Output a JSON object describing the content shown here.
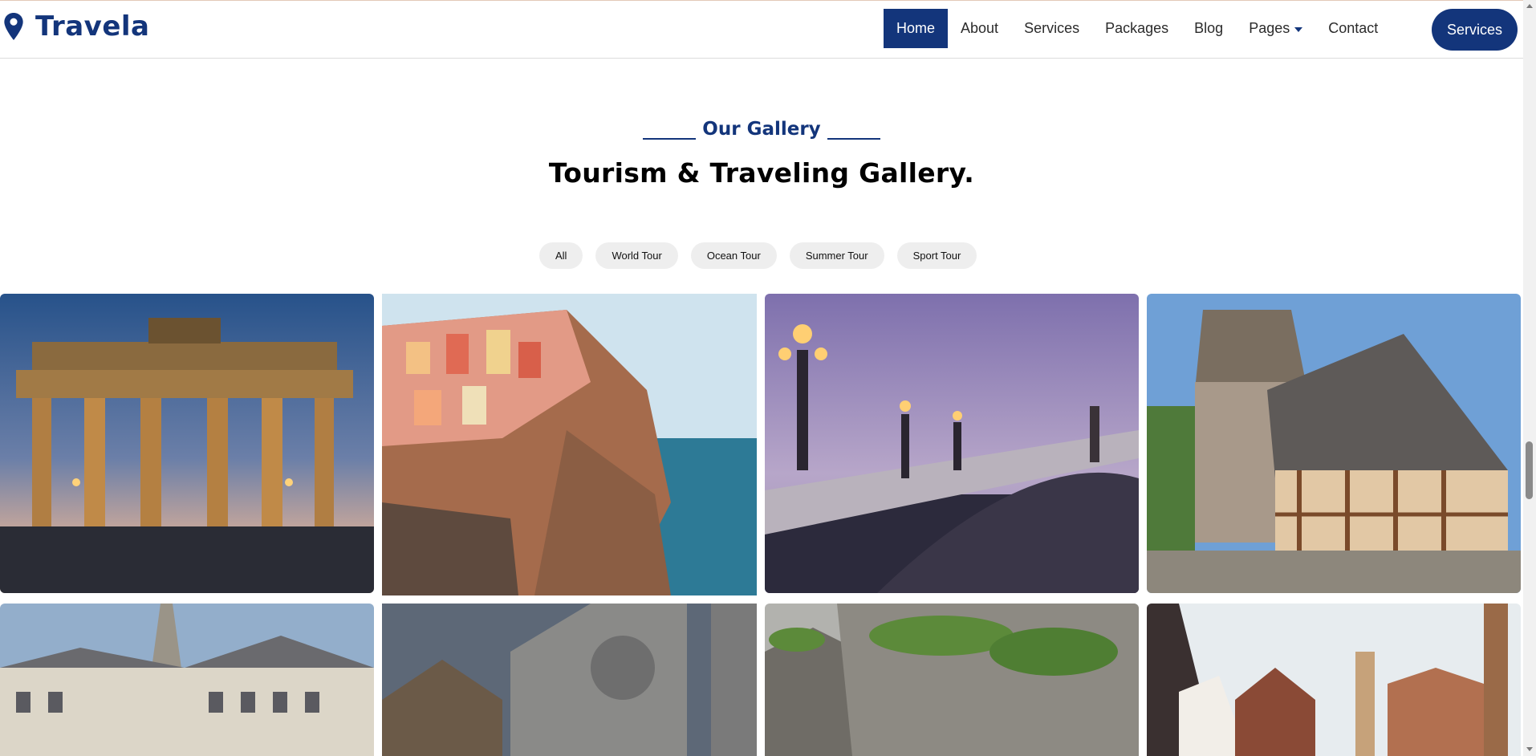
{
  "brand": {
    "name": "Travela",
    "logo_icon": "map-pin-icon",
    "color": "#13357b"
  },
  "nav": {
    "items": [
      {
        "label": "Home",
        "active": true
      },
      {
        "label": "About"
      },
      {
        "label": "Services"
      },
      {
        "label": "Packages"
      },
      {
        "label": "Blog"
      },
      {
        "label": "Pages",
        "dropdown": true
      },
      {
        "label": "Contact"
      }
    ],
    "cta_label": "Services"
  },
  "gallery": {
    "eyebrow": "Our Gallery",
    "title": "Tourism & Traveling Gallery.",
    "filters": [
      "All",
      "World Tour",
      "Ocean Tour",
      "Summer Tour",
      "Sport Tour"
    ],
    "images": [
      {
        "name": "brandenburg-gate-photo",
        "subject": "brandenburg gate at dusk"
      },
      {
        "name": "cliffside-village-photo",
        "subject": "colorful cliffside village by the sea"
      },
      {
        "name": "ornate-bridge-photo",
        "subject": "ornate bridge with lamps at twilight"
      },
      {
        "name": "timber-house-photo",
        "subject": "half-timbered medieval houses"
      },
      {
        "name": "city-buildings-photo",
        "subject": "city buildings with church spire"
      },
      {
        "name": "gothic-cathedral-photo",
        "subject": "gothic cathedral facade"
      },
      {
        "name": "karst-cliffs-photo",
        "subject": "green karst limestone cliffs"
      },
      {
        "name": "old-town-photo",
        "subject": "old town timber houses"
      }
    ]
  }
}
